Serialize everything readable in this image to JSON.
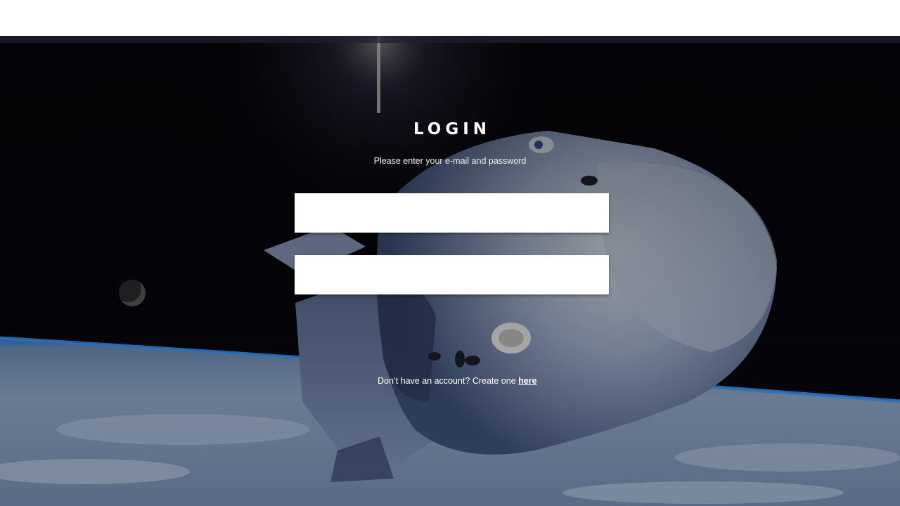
{
  "login": {
    "title": "LOGIN",
    "subtitle": "Please enter your e-mail and password",
    "email": {
      "value": "",
      "placeholder": ""
    },
    "password": {
      "value": "",
      "placeholder": ""
    },
    "signup_prompt": "Don’t have an account? Create one ",
    "signup_link": "here"
  },
  "background": {
    "scene": "spacecraft-over-earth",
    "colors": {
      "space": "#06060c",
      "earth_cloud": "#8fa8c8",
      "atmosphere": "#1f6fd6",
      "capsule": "#c9d3e3"
    }
  }
}
